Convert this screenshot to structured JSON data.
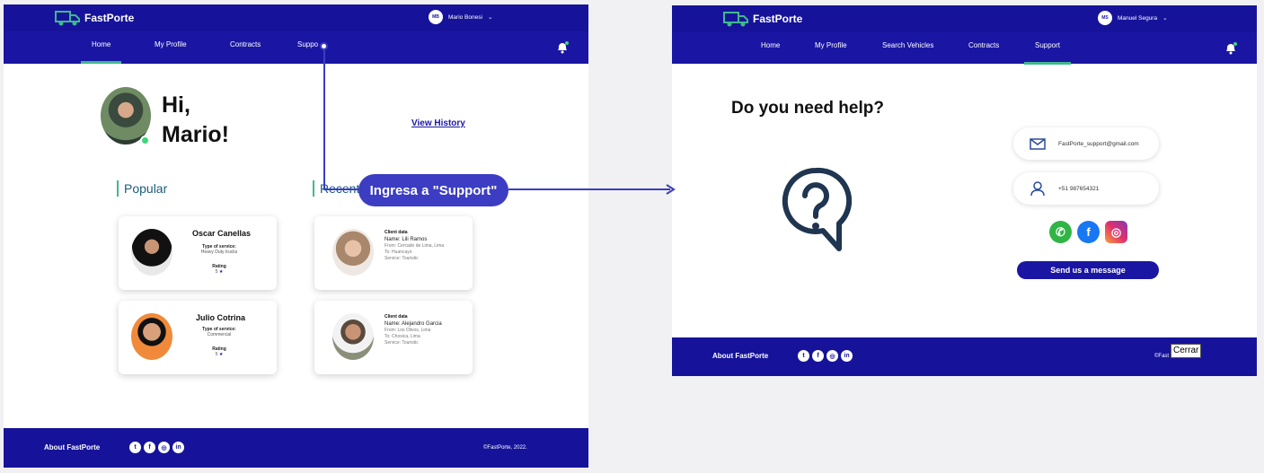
{
  "annotation": {
    "callout": "Ingresa a \"Support\""
  },
  "screen1": {
    "brand": "FastPorte",
    "user": {
      "initials": "MB",
      "name": "Mario Bonesi"
    },
    "nav": [
      "Home",
      "My Profile",
      "Contracts",
      "Suppo"
    ],
    "greeting_line1": "Hi,",
    "greeting_line2": "Mario!",
    "view_history": "View History",
    "popular_title": "Popular",
    "recent_title": "Recent",
    "popular": [
      {
        "name": "Oscar Canellas",
        "service_label": "Type of service:",
        "service": "Heavy Duty trucks",
        "rating_label": "Rating",
        "rating": "5"
      },
      {
        "name": "Julio Cotrina",
        "service_label": "Type of service:",
        "service": "Commercial",
        "rating_label": "Rating",
        "rating": "5"
      }
    ],
    "recent": [
      {
        "title": "Client data",
        "name": "Name: Lili Ramos",
        "from": "From: Cercado de Lima, Lima",
        "to": "To: Huancayo",
        "service": "Service: Touristic"
      },
      {
        "title": "Client data",
        "name": "Name: Alejandro Garcia",
        "from": "From: Los Olivos, Lima",
        "to": "To: Chosica, Lima",
        "service": "Service: Touristic"
      }
    ],
    "footer": {
      "about": "About FastPorte",
      "copyright": "©FastPorte, 2022."
    }
  },
  "screen2": {
    "brand": "FastPorte",
    "user": {
      "initials": "MS",
      "name": "Manuel Segura"
    },
    "nav": [
      "Home",
      "My Profile",
      "Search Vehicles",
      "Contracts",
      "Support"
    ],
    "help_title": "Do you need help?",
    "email": "FastPorte_support@gmail.com",
    "phone": "+51 987654321",
    "send_button": "Send us a message",
    "footer": {
      "about": "About FastPorte",
      "copyright": "©Fast"
    },
    "tooltip": "Cerrar"
  },
  "colors": {
    "navy": "#1a16a3",
    "accent": "#3fb98a",
    "callout": "#3c3dc2"
  }
}
